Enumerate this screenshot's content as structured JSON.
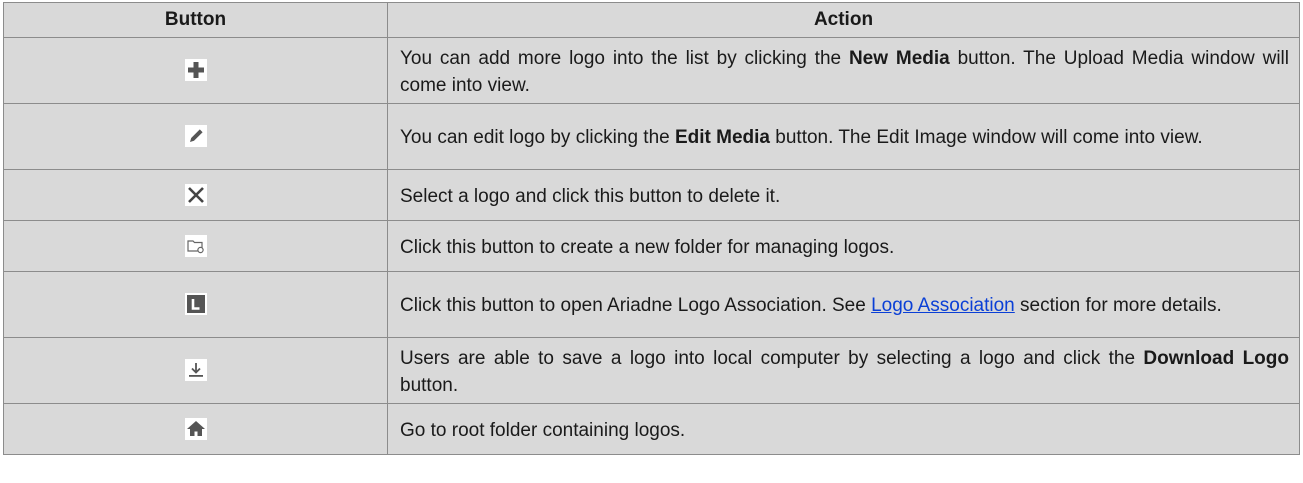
{
  "header": {
    "col_button": "Button",
    "col_action": "Action"
  },
  "rows": [
    {
      "icon": "plus-icon",
      "pre": "You can add more logo into the list by clicking the ",
      "bold": "New Media",
      "post": " button. The Upload Media window will come into view."
    },
    {
      "icon": "pencil-icon",
      "pre": "You can edit logo by clicking the ",
      "bold": "Edit Media",
      "post": " button. The Edit Image window will come into view."
    },
    {
      "icon": "close-icon",
      "text": "Select a logo and click this button to delete it."
    },
    {
      "icon": "new-folder-icon",
      "text": "Click this button to create a new folder for managing logos."
    },
    {
      "icon": "logo-association-icon",
      "pre": "Click this button to open Ariadne Logo Association. See ",
      "link": "Logo Association",
      "post": " section for more details."
    },
    {
      "icon": "download-icon",
      "pre": "Users are able to save a logo into local computer by selecting a logo and click the ",
      "bold": "Download Logo",
      "post": " button."
    },
    {
      "icon": "home-icon",
      "text": "Go to root folder containing logos."
    }
  ],
  "colors": {
    "cell_bg": "#d9d9d9",
    "border": "#8c8c8c",
    "icon_gray": "#5a5a5a",
    "link": "#0a3fd6"
  }
}
